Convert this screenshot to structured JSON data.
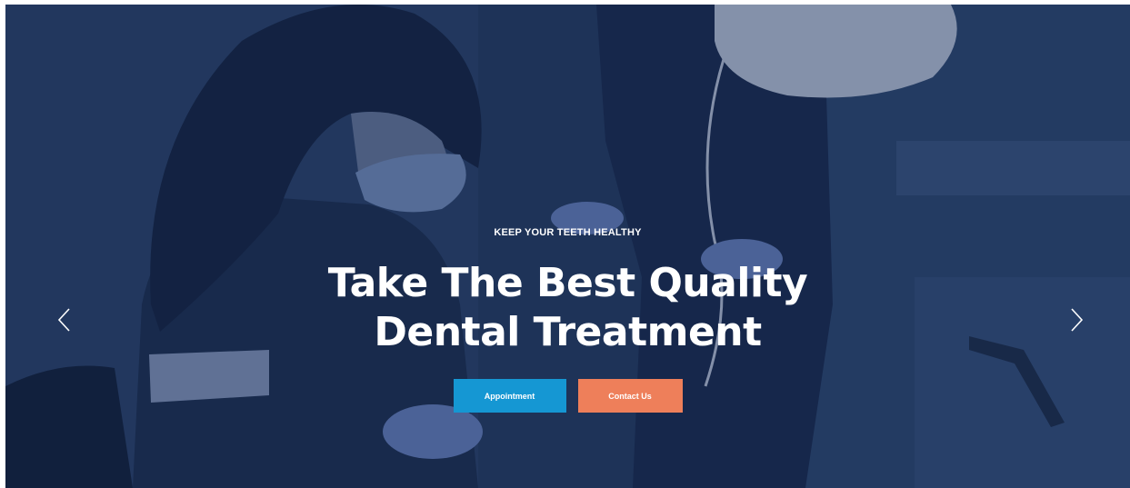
{
  "hero": {
    "eyebrow": "KEEP YOUR TEETH HEALTHY",
    "headline_line1": "Take The Best Quality",
    "headline_line2": "Dental Treatment",
    "buttons": {
      "appointment": "Appointment",
      "contact": "Contact Us"
    },
    "colors": {
      "primary": "#1597d3",
      "secondary": "#ee7f5a",
      "overlay": "#1e3355"
    },
    "icons": {
      "prev": "chevron-left-icon",
      "next": "chevron-right-icon"
    }
  }
}
